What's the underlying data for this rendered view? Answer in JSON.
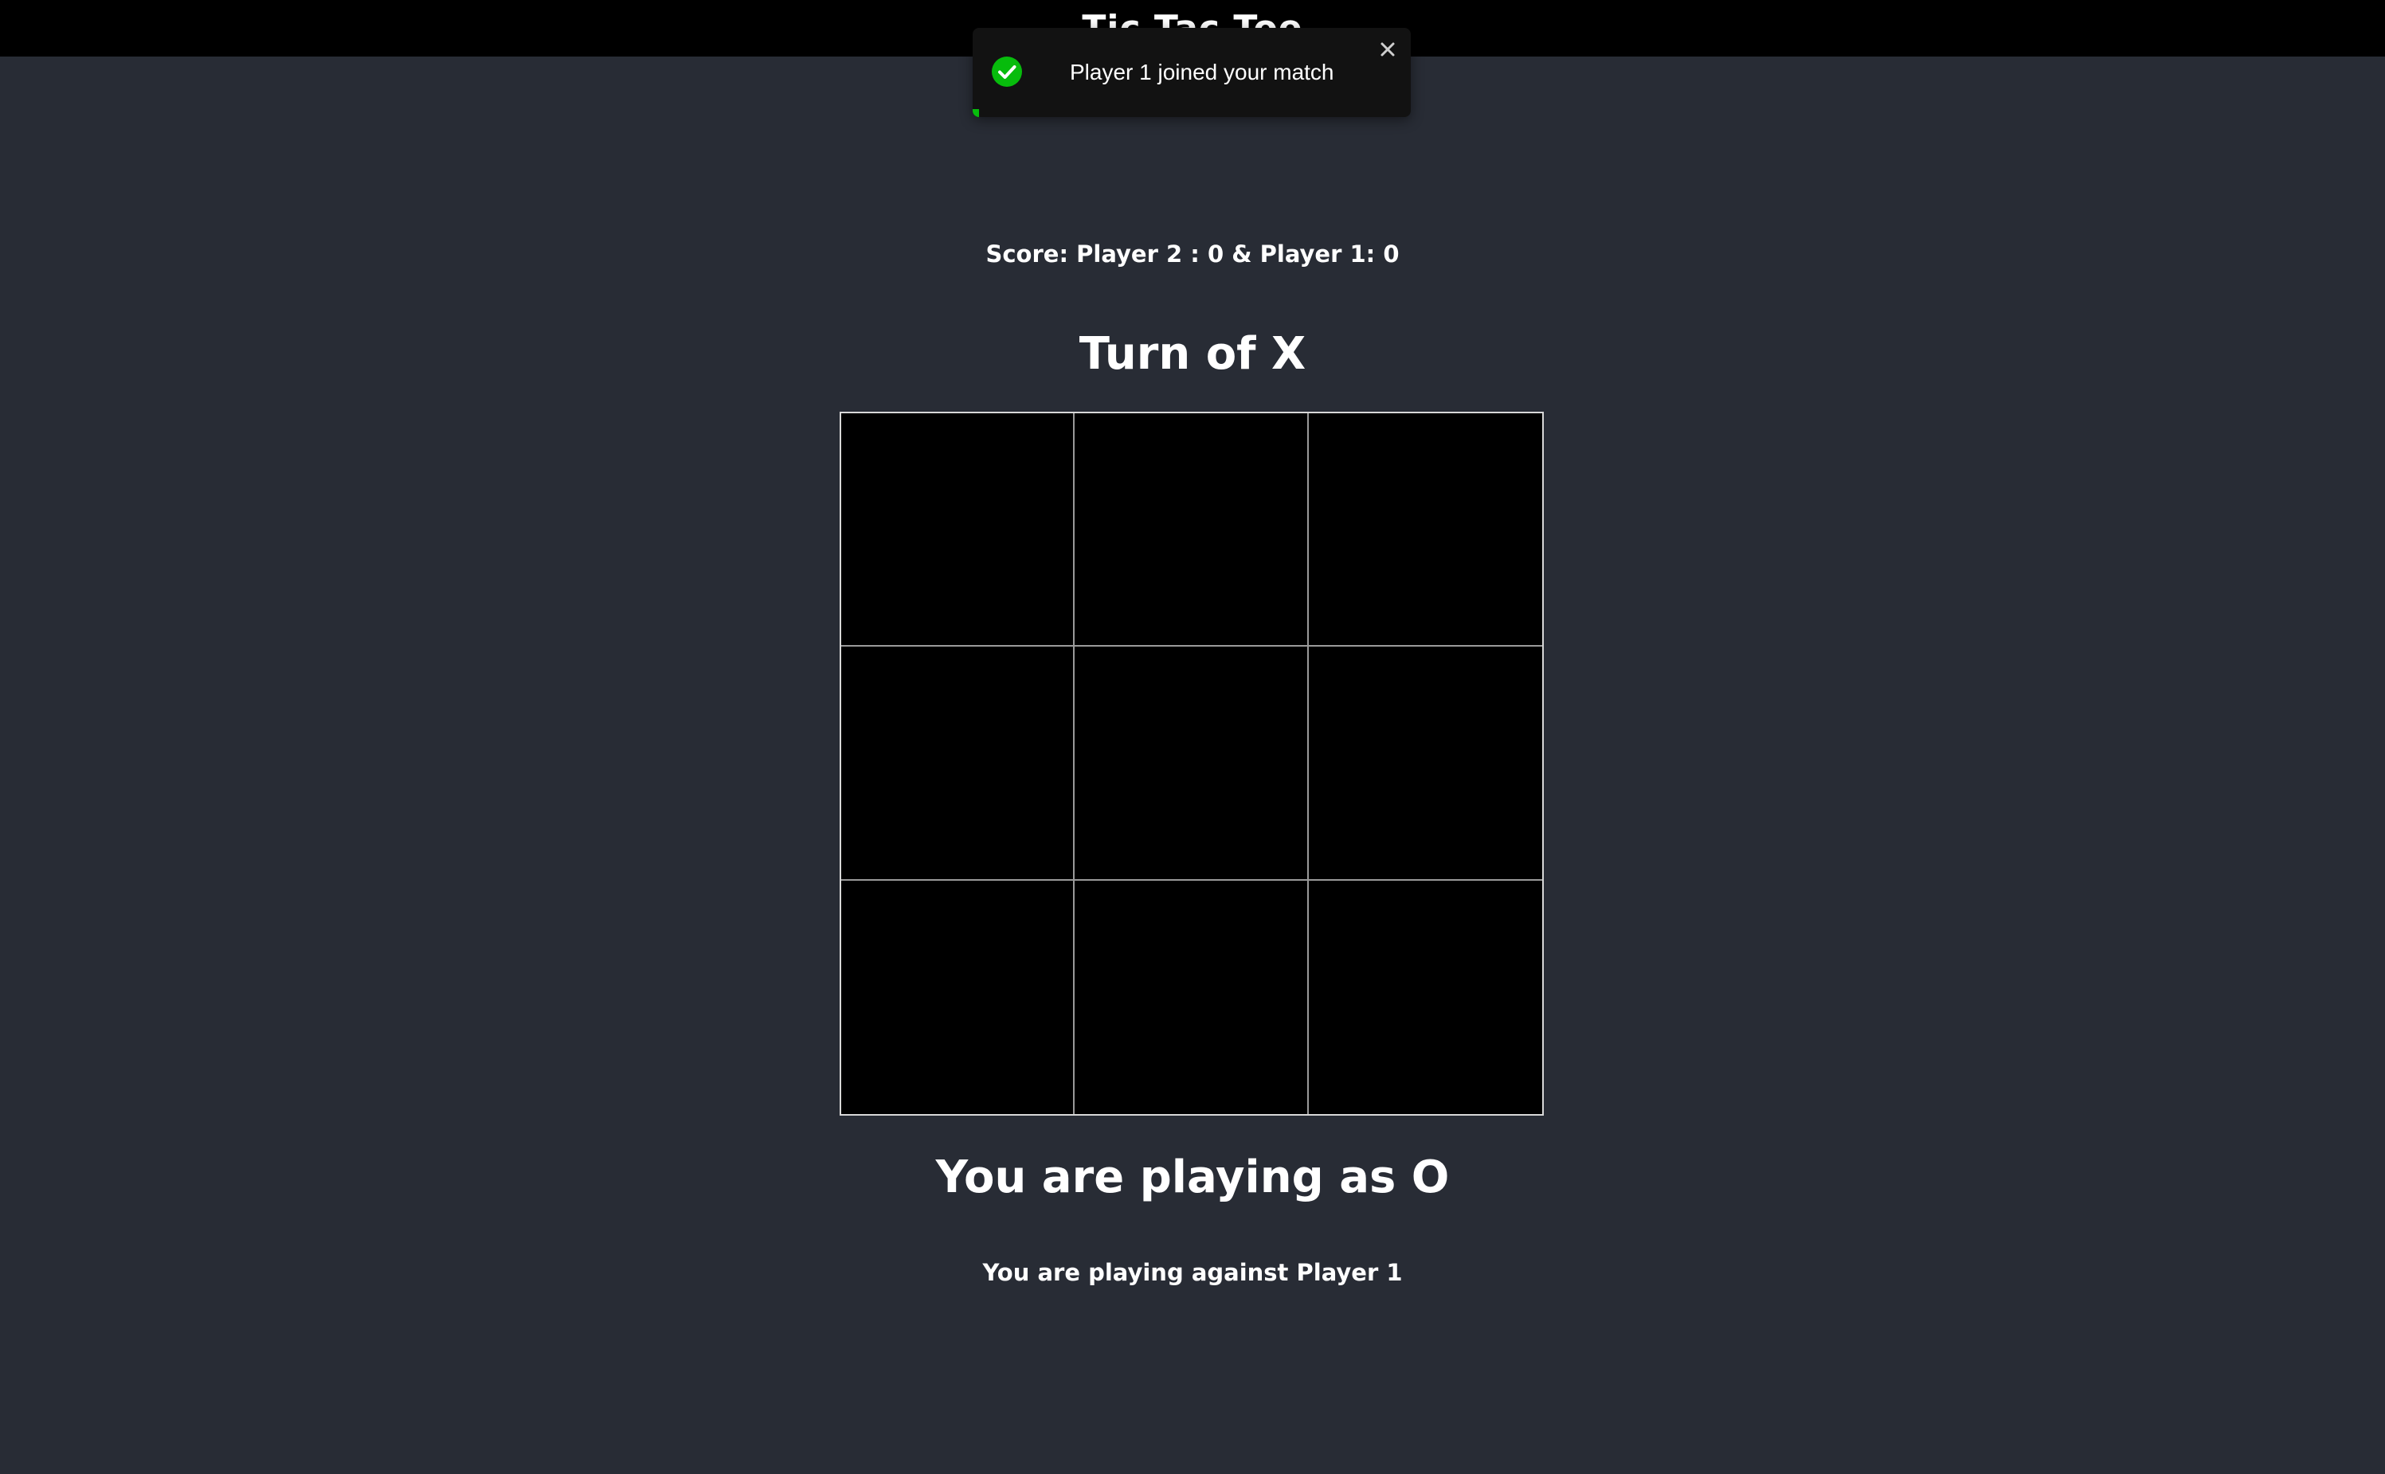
{
  "header": {
    "title": "Tic Tac Toe"
  },
  "toast": {
    "message": "Player 1 joined your match",
    "icon": "check-circle-icon",
    "close_icon": "close-icon",
    "progress_fraction": 0.015,
    "accent_color": "#07bc0c"
  },
  "game": {
    "score_text": "Score: Player 2 : 0 & Player 1: 0",
    "turn_text": "Turn of X",
    "playing_as_text": "You are playing as O",
    "opponent_text": "You are playing against Player 1",
    "board": [
      [
        "",
        "",
        ""
      ],
      [
        "",
        "",
        ""
      ],
      [
        "",
        "",
        ""
      ]
    ]
  },
  "colors": {
    "page_background": "#282c35",
    "top_bar": "#000000",
    "board_background": "#000000"
  }
}
